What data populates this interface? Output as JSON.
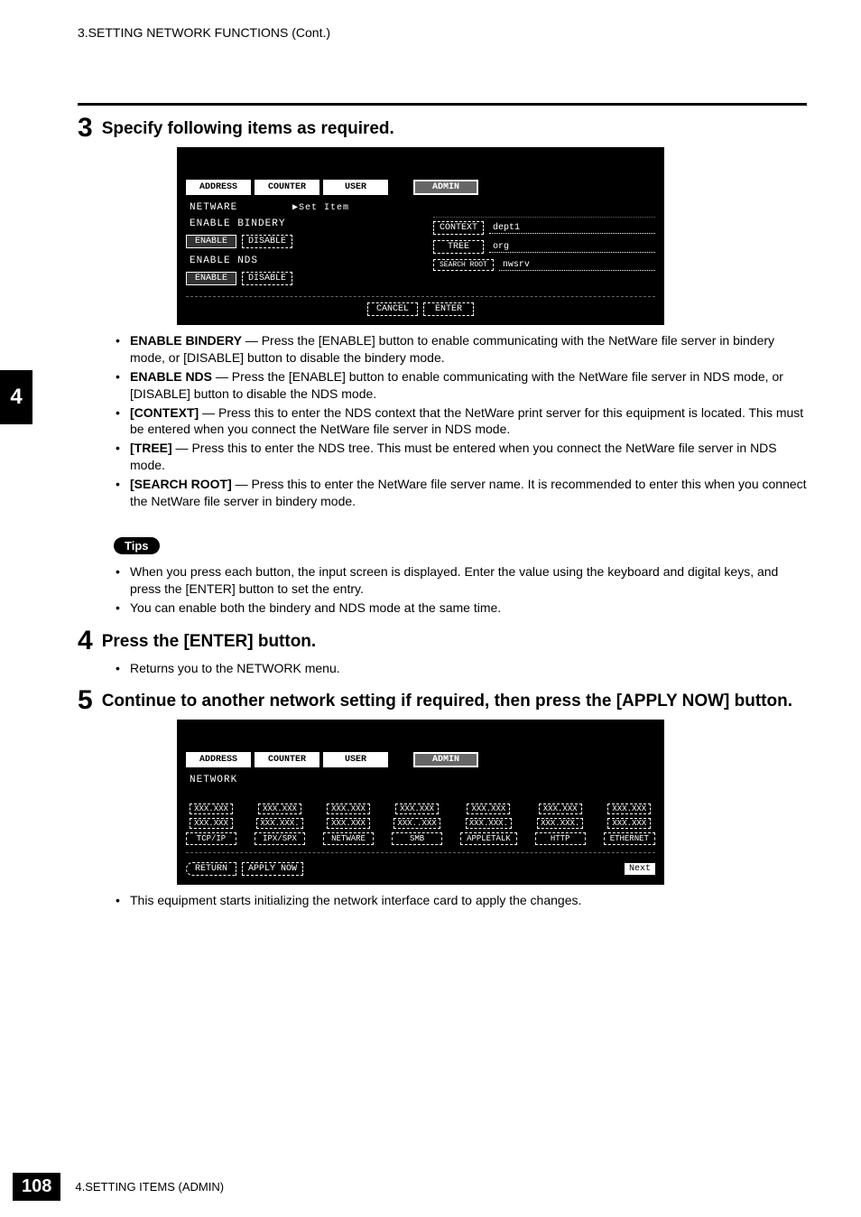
{
  "running_header": "3.SETTING NETWORK FUNCTIONS (Cont.)",
  "side_tab": "4",
  "step3": {
    "num": "3",
    "title": "Specify following items as required."
  },
  "ss1": {
    "tabs": [
      "ADDRESS",
      "COUNTER",
      "USER",
      "ADMIN"
    ],
    "line_left_header": "NETWARE",
    "set_item": "▶Set Item",
    "bindery_label": "ENABLE BINDERY",
    "nds_label": "ENABLE NDS",
    "enable": "ENABLE",
    "disable": "DISABLE",
    "context_label": "CONTEXT",
    "context_val": "dept1",
    "tree_label": "TREE",
    "tree_val": "org",
    "search_label": "SEARCH ROOT",
    "search_val": "nwsrv",
    "cancel": "CANCEL",
    "enter": "ENTER"
  },
  "bullets1": {
    "b1_term": "ENABLE BINDERY",
    "b1_rest": " — Press the [ENABLE] button to enable communicating with the NetWare file server in bindery mode, or [DISABLE] button to disable the bindery mode.",
    "b2_term": "ENABLE NDS",
    "b2_rest": " — Press the [ENABLE] button to enable communicating with the NetWare file server in NDS mode, or [DISABLE] button to disable the NDS mode.",
    "b3_term": "[CONTEXT]",
    "b3_rest": " — Press this to enter the NDS context that the NetWare print server for this equipment is located. This must be entered when you connect the NetWare file server in NDS mode.",
    "b4_term": "[TREE]",
    "b4_rest": " — Press this to enter the NDS tree.  This must be entered when you connect the NetWare file server in NDS mode.",
    "b5_term": "[SEARCH ROOT]",
    "b5_rest": " — Press this to enter the NetWare file server name.  It is recommended to enter this when you connect the NetWare file server in bindery mode."
  },
  "tips_label": "Tips",
  "tips": {
    "t1": "When you press each button, the input screen is displayed.  Enter the value using the keyboard and digital keys, and press the [ENTER] button to set the entry.",
    "t2": "You can enable both the bindery and NDS mode at the same time."
  },
  "step4": {
    "num": "4",
    "title": "Press the [ENTER] button.",
    "bullet": "Returns you to the NETWORK menu."
  },
  "step5": {
    "num": "5",
    "title": "Continue to another network setting if required, then press the [APPLY NOW] button."
  },
  "ss2": {
    "tabs": [
      "ADDRESS",
      "COUNTER",
      "USER",
      "ADMIN"
    ],
    "header": "NETWORK",
    "cols": [
      {
        "v1": "XXX.XXX",
        "v2": "XXX.XXX",
        "name": "TCP/IP"
      },
      {
        "v1": "XXX.XXX",
        "v2": "XXX.XXX.",
        "name": "IPX/SPX"
      },
      {
        "v1": "XXX.XXX",
        "v2": "XXX.XXX",
        "name": "NETWARE"
      },
      {
        "v1": "XXX.XXX",
        "v2": "XXX..XXX",
        "name": "SMB"
      },
      {
        "v1": "XXX.XXX",
        "v2": "XXX.XXX.",
        "name": "APPLETALK"
      },
      {
        "v1": "XXX.XXX",
        "v2": "XXX.XXX.",
        "name": "HTTP"
      },
      {
        "v1": "XXX.XXX",
        "v2": "XXX.XXX",
        "name": "ETHERNET"
      }
    ],
    "return": "RETURN",
    "apply": "APPLY NOW",
    "next": "Next"
  },
  "after5_bullet": "This equipment starts initializing the network interface card to apply the changes.",
  "footer": {
    "page": "108",
    "text": "4.SETTING ITEMS (ADMIN)"
  }
}
